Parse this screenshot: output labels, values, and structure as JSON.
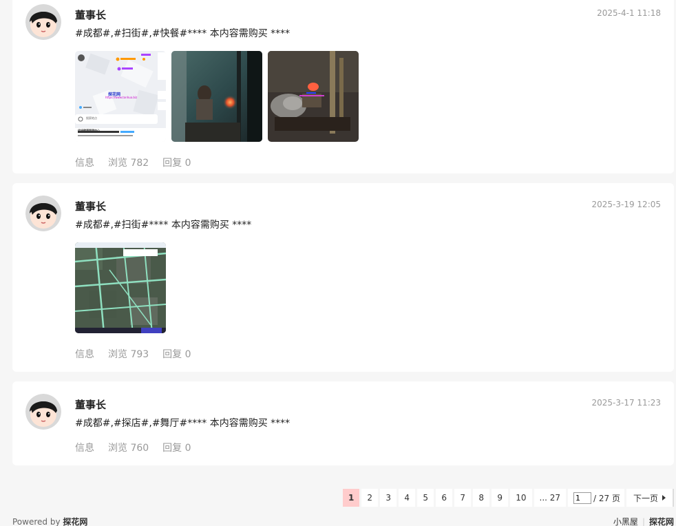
{
  "posts": [
    {
      "author": "董事长",
      "date": "2025-4-1 11:18",
      "content": "#成都#,#扫街#,#快餐#**** 本内容需购买 ****",
      "info_label": "信息",
      "views": "浏览 782",
      "replies": "回复 0",
      "map_popup": {
        "title": "探花网",
        "url": "https://www.tanhua.biz",
        "place": "佳妍健康管理中心",
        "search": "搜索地点"
      }
    },
    {
      "author": "董事长",
      "date": "2025-3-19 12:05",
      "content": "#成都#,#扫街#**** 本内容需购买 ****",
      "info_label": "信息",
      "views": "浏览 793",
      "replies": "回复 0"
    },
    {
      "author": "董事长",
      "date": "2025-3-17 11:23",
      "content": "#成都#,#探店#,#舞厅#**** 本内容需购买 ****",
      "info_label": "信息",
      "views": "浏览 760",
      "replies": "回复 0"
    }
  ],
  "pagination": {
    "pages": [
      "1",
      "2",
      "3",
      "4",
      "5",
      "6",
      "7",
      "8",
      "9",
      "10"
    ],
    "current": "1",
    "last": "... 27",
    "jump_value": "1",
    "total": "/ 27 页",
    "next": "下一页"
  },
  "footer": {
    "powered_by": "Powered by",
    "site": "探花网",
    "link1": "小黑屋",
    "link2": "探花网"
  },
  "colors": {
    "active_page": "#ffcccc",
    "meta_text": "#999999"
  }
}
